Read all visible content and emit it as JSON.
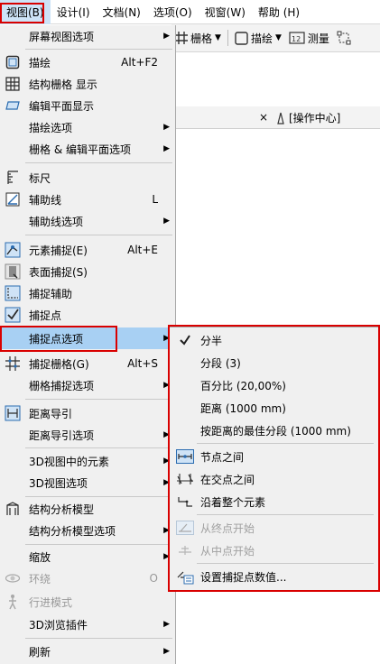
{
  "menubar": {
    "items": [
      {
        "label": "视图(B)",
        "active": true
      },
      {
        "label": "设计(I)"
      },
      {
        "label": "文档(N)"
      },
      {
        "label": "选项(O)"
      },
      {
        "label": "视窗(W)"
      },
      {
        "label": "帮助 (H)"
      }
    ]
  },
  "toolbar": {
    "grid_label": "栅格",
    "trace_label": "描绘",
    "measure_label": "测量"
  },
  "tab": {
    "close": "×",
    "label": "[操作中心]"
  },
  "menu": {
    "items": [
      {
        "label": "屏幕视图选项",
        "arrow": "▶",
        "icon": "none"
      },
      {
        "label": "描绘",
        "shortcut": "Alt+F2",
        "icon": "trace-icon"
      },
      {
        "label": "结构栅格 显示",
        "icon": "grid-icon"
      },
      {
        "label": "编辑平面显示",
        "icon": "edit-plane-icon"
      },
      {
        "label": "描绘选项",
        "arrow": "▶"
      },
      {
        "label": "栅格 & 编辑平面选项",
        "arrow": "▶"
      },
      {
        "label": "标尺",
        "icon": "ruler-icon"
      },
      {
        "label": "辅助线",
        "shortcut": "L",
        "icon": "guide-line-icon"
      },
      {
        "label": "辅助线选项",
        "arrow": "▶"
      },
      {
        "label": "元素捕捉(E)",
        "shortcut": "Alt+E",
        "icon": "element-snap-icon"
      },
      {
        "label": "表面捕捉(S)",
        "icon": "surface-snap-icon"
      },
      {
        "label": "捕捉辅助",
        "icon": "snap-guide-icon"
      },
      {
        "label": "捕捉点",
        "icon": "snap-point-icon"
      },
      {
        "label": "捕捉点选项",
        "arrow": "▶",
        "highlighted": true
      },
      {
        "label": "捕捉栅格(G)",
        "shortcut": "Alt+S",
        "icon": "snap-grid-icon"
      },
      {
        "label": "栅格捕捉选项",
        "arrow": "▶"
      },
      {
        "label": "距离导引",
        "icon": "distance-guide-icon"
      },
      {
        "label": "距离导引选项",
        "arrow": "▶"
      },
      {
        "label": "3D视图中的元素",
        "arrow": "▶"
      },
      {
        "label": "3D视图选项",
        "arrow": "▶"
      },
      {
        "label": "结构分析模型",
        "icon": "structural-model-icon"
      },
      {
        "label": "结构分析模型选项",
        "arrow": "▶"
      },
      {
        "label": "缩放",
        "arrow": "▶"
      },
      {
        "label": "环绕",
        "shortcut": "O",
        "icon": "orbit-icon",
        "disabled": true
      },
      {
        "label": "行进模式",
        "icon": "walk-icon",
        "disabled": true
      },
      {
        "label": "3D浏览插件",
        "arrow": "▶"
      },
      {
        "label": "刷新",
        "arrow": "▶"
      }
    ]
  },
  "submenu": {
    "items": [
      {
        "label": "分半",
        "icon": "checkmark-icon"
      },
      {
        "label": "分段 (3)"
      },
      {
        "label": "百分比 (20,00%)"
      },
      {
        "label": "距离 (1000 mm)"
      },
      {
        "label": "按距离的最佳分段 (1000 mm)"
      },
      {
        "label": "节点之间",
        "icon": "between-nodes-icon"
      },
      {
        "label": "在交点之间",
        "icon": "between-intersections-icon"
      },
      {
        "label": "沿着整个元素",
        "icon": "along-element-icon"
      },
      {
        "label": "从终点开始",
        "icon": "from-endpoint-icon",
        "disabled": true
      },
      {
        "label": "从中点开始",
        "icon": "from-midpoint-icon",
        "disabled": true
      },
      {
        "label": "设置捕捉点数值...",
        "icon": "set-snap-values-icon"
      }
    ]
  },
  "colors": {
    "highlight": "#a8d0f3",
    "menubar_active": "#cde3f7",
    "annotation_red": "#d90000",
    "menu_bg": "#f0f0f0"
  }
}
